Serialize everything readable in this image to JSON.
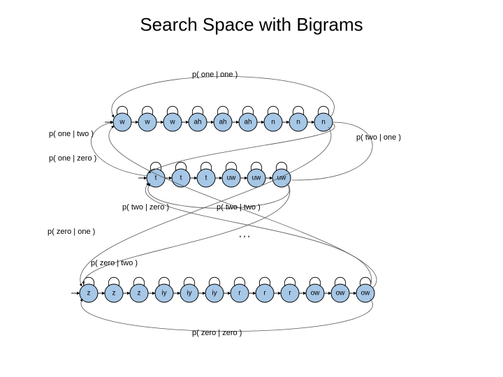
{
  "title": "Search Space with Bigrams",
  "ellipsis": "...",
  "rows": {
    "one": {
      "states": [
        "w",
        "w",
        "w",
        "ah",
        "ah",
        "ah",
        "n",
        "n",
        "n"
      ]
    },
    "two": {
      "states": [
        "t",
        "t",
        "t",
        "uw",
        "uw",
        "uw"
      ]
    },
    "zero": {
      "states": [
        "z",
        "z",
        "z",
        "iy",
        "iy",
        "iy",
        "r",
        "r",
        "r",
        "ow",
        "ow",
        "ow"
      ]
    }
  },
  "labels": {
    "one_one": "p( one | one )",
    "two_one": "p( two | one )",
    "one_two": "p( one | two )",
    "one_zero": "p( one | zero )",
    "two_zero": "p( two | zero )",
    "two_two": "p( two | two )",
    "zero_one": "p( zero | one )",
    "zero_two": "p( zero | two )",
    "zero_zero": "p( zero | zero )"
  }
}
